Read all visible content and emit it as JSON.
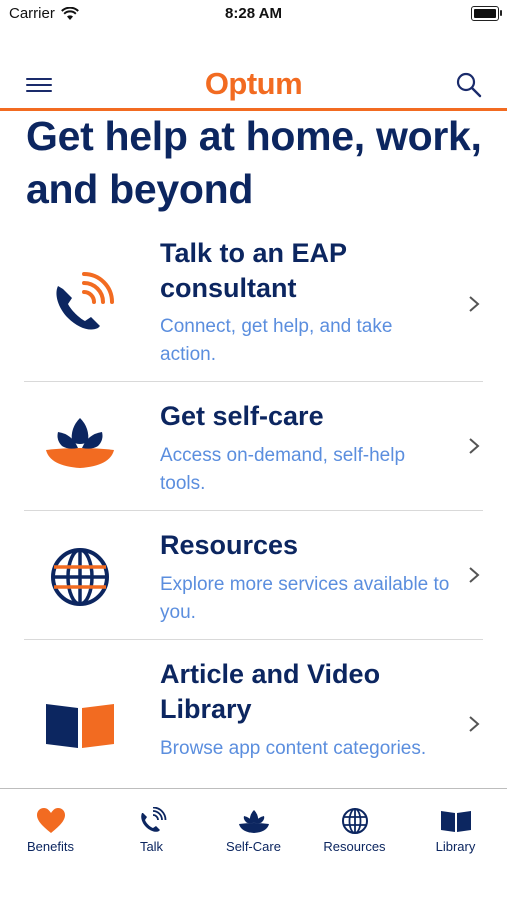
{
  "status_bar": {
    "carrier": "Carrier",
    "time": "8:28 AM"
  },
  "header": {
    "brand": "Optum",
    "menu_icon": "hamburger-menu-icon",
    "search_icon": "search-icon"
  },
  "page_title": "Get help at home, work, and beyond",
  "items": [
    {
      "title": "Talk to an EAP consultant",
      "subtitle": "Connect, get help, and take action.",
      "icon": "phone-icon"
    },
    {
      "title": "Get self-care",
      "subtitle": "Access on-demand, self-help tools.",
      "icon": "lotus-icon"
    },
    {
      "title": "Resources",
      "subtitle": "Explore more services available to you.",
      "icon": "globe-icon"
    },
    {
      "title": "Article and Video Library",
      "subtitle": "Browse app content categories.",
      "icon": "book-icon"
    }
  ],
  "tabs": [
    {
      "label": "Benefits",
      "icon": "heart-icon"
    },
    {
      "label": "Talk",
      "icon": "phone-icon"
    },
    {
      "label": "Self-Care",
      "icon": "lotus-icon"
    },
    {
      "label": "Resources",
      "icon": "globe-icon"
    },
    {
      "label": "Library",
      "icon": "book-icon"
    }
  ],
  "colors": {
    "brand": "#f26b21",
    "navy": "#0c2660",
    "link": "#5b8ede",
    "active_tab": "#f26b21"
  }
}
